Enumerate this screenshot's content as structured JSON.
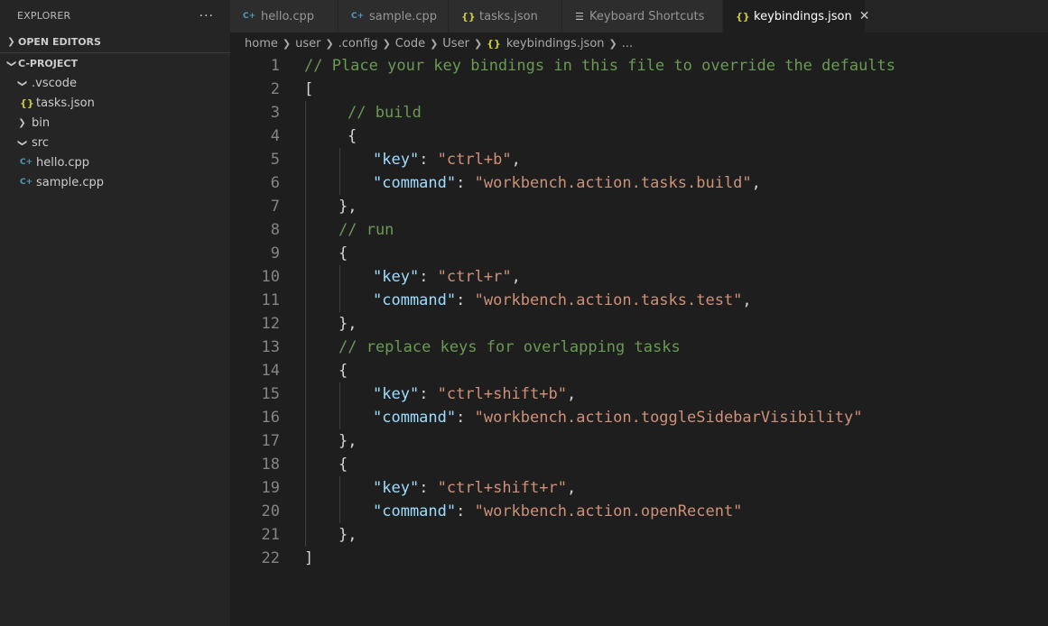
{
  "sidebar": {
    "title": "EXPLORER",
    "more": "···",
    "open_editors": "OPEN EDITORS",
    "project": "C-PROJECT",
    "tree": [
      {
        "label": ".vscode",
        "type": "folder-open",
        "icon": "chevron-down-icon"
      },
      {
        "label": "tasks.json",
        "type": "json"
      },
      {
        "label": "bin",
        "type": "folder-closed",
        "icon": "chevron-right-icon"
      },
      {
        "label": "src",
        "type": "folder-open",
        "icon": "chevron-down-icon"
      },
      {
        "label": "hello.cpp",
        "type": "cpp"
      },
      {
        "label": "sample.cpp",
        "type": "cpp"
      }
    ]
  },
  "tabs": [
    {
      "label": "hello.cpp",
      "icon": "cpp-file-icon"
    },
    {
      "label": "sample.cpp",
      "icon": "cpp-file-icon"
    },
    {
      "label": "tasks.json",
      "icon": "json-file-icon"
    },
    {
      "label": "Keyboard Shortcuts",
      "icon": "keyboard-shortcuts-icon"
    },
    {
      "label": "keybindings.json",
      "icon": "json-file-icon",
      "active": true
    }
  ],
  "breadcrumb": [
    "home",
    "user",
    ".config",
    "Code",
    "User",
    "keybindings.json",
    "..."
  ],
  "editor": {
    "lines": [
      {
        "n": "1",
        "indent": 0,
        "tokens": [
          {
            "t": "// Place your key bindings in this file to override the defaults",
            "c": "comment"
          }
        ]
      },
      {
        "n": "2",
        "indent": 0,
        "tokens": [
          {
            "t": "[",
            "c": "punc"
          }
        ]
      },
      {
        "n": "3",
        "indent": 2,
        "tokens": [
          {
            "t": "// build",
            "c": "comment"
          }
        ]
      },
      {
        "n": "4",
        "indent": 2,
        "tokens": [
          {
            "t": "{",
            "c": "punc"
          }
        ]
      },
      {
        "n": "5",
        "indent": 3,
        "tokens": [
          {
            "t": "\"key\"",
            "c": "key"
          },
          {
            "t": ": ",
            "c": "punc"
          },
          {
            "t": "\"ctrl+b\"",
            "c": "str"
          },
          {
            "t": ",",
            "c": "punc"
          }
        ]
      },
      {
        "n": "6",
        "indent": 3,
        "tokens": [
          {
            "t": "\"command\"",
            "c": "key"
          },
          {
            "t": ": ",
            "c": "punc"
          },
          {
            "t": "\"workbench.action.tasks.build\"",
            "c": "str"
          },
          {
            "t": ",",
            "c": "punc"
          }
        ]
      },
      {
        "n": "7",
        "indent": 1,
        "tokens": [
          {
            "t": "},",
            "c": "punc"
          }
        ]
      },
      {
        "n": "8",
        "indent": 1,
        "tokens": [
          {
            "t": "// run",
            "c": "comment"
          }
        ]
      },
      {
        "n": "9",
        "indent": 1,
        "tokens": [
          {
            "t": "{",
            "c": "punc"
          }
        ]
      },
      {
        "n": "10",
        "indent": 3,
        "tokens": [
          {
            "t": "\"key\"",
            "c": "key"
          },
          {
            "t": ": ",
            "c": "punc"
          },
          {
            "t": "\"ctrl+r\"",
            "c": "str"
          },
          {
            "t": ",",
            "c": "punc"
          }
        ]
      },
      {
        "n": "11",
        "indent": 3,
        "tokens": [
          {
            "t": "\"command\"",
            "c": "key"
          },
          {
            "t": ": ",
            "c": "punc"
          },
          {
            "t": "\"workbench.action.tasks.test\"",
            "c": "str"
          },
          {
            "t": ",",
            "c": "punc"
          }
        ]
      },
      {
        "n": "12",
        "indent": 1,
        "tokens": [
          {
            "t": "},",
            "c": "punc"
          }
        ]
      },
      {
        "n": "13",
        "indent": 1,
        "tokens": [
          {
            "t": "// replace keys for overlapping tasks",
            "c": "comment"
          }
        ]
      },
      {
        "n": "14",
        "indent": 1,
        "tokens": [
          {
            "t": "{",
            "c": "punc"
          }
        ]
      },
      {
        "n": "15",
        "indent": 3,
        "tokens": [
          {
            "t": "\"key\"",
            "c": "key"
          },
          {
            "t": ": ",
            "c": "punc"
          },
          {
            "t": "\"ctrl+shift+b\"",
            "c": "str"
          },
          {
            "t": ",",
            "c": "punc"
          }
        ]
      },
      {
        "n": "16",
        "indent": 3,
        "tokens": [
          {
            "t": "\"command\"",
            "c": "key"
          },
          {
            "t": ": ",
            "c": "punc"
          },
          {
            "t": "\"workbench.action.toggleSidebarVisibility\"",
            "c": "str"
          }
        ]
      },
      {
        "n": "17",
        "indent": 1,
        "tokens": [
          {
            "t": "},",
            "c": "punc"
          }
        ]
      },
      {
        "n": "18",
        "indent": 1,
        "tokens": [
          {
            "t": "{",
            "c": "punc"
          }
        ]
      },
      {
        "n": "19",
        "indent": 3,
        "tokens": [
          {
            "t": "\"key\"",
            "c": "key"
          },
          {
            "t": ": ",
            "c": "punc"
          },
          {
            "t": "\"ctrl+shift+r\"",
            "c": "str"
          },
          {
            "t": ",",
            "c": "punc"
          }
        ]
      },
      {
        "n": "20",
        "indent": 3,
        "tokens": [
          {
            "t": "\"command\"",
            "c": "key"
          },
          {
            "t": ": ",
            "c": "punc"
          },
          {
            "t": "\"workbench.action.openRecent\"",
            "c": "str"
          }
        ]
      },
      {
        "n": "21",
        "indent": 1,
        "tokens": [
          {
            "t": "},",
            "c": "punc"
          }
        ]
      },
      {
        "n": "22",
        "indent": 0,
        "tokens": [
          {
            "t": "]",
            "c": "punc"
          }
        ]
      }
    ]
  },
  "colors": {
    "background": "#1e1e1e",
    "sidebar": "#252526",
    "comment": "#6a9955",
    "key": "#9cdcfe",
    "string": "#ce9178",
    "json_icon": "#cbcb41",
    "cpp_icon": "#519aba"
  }
}
